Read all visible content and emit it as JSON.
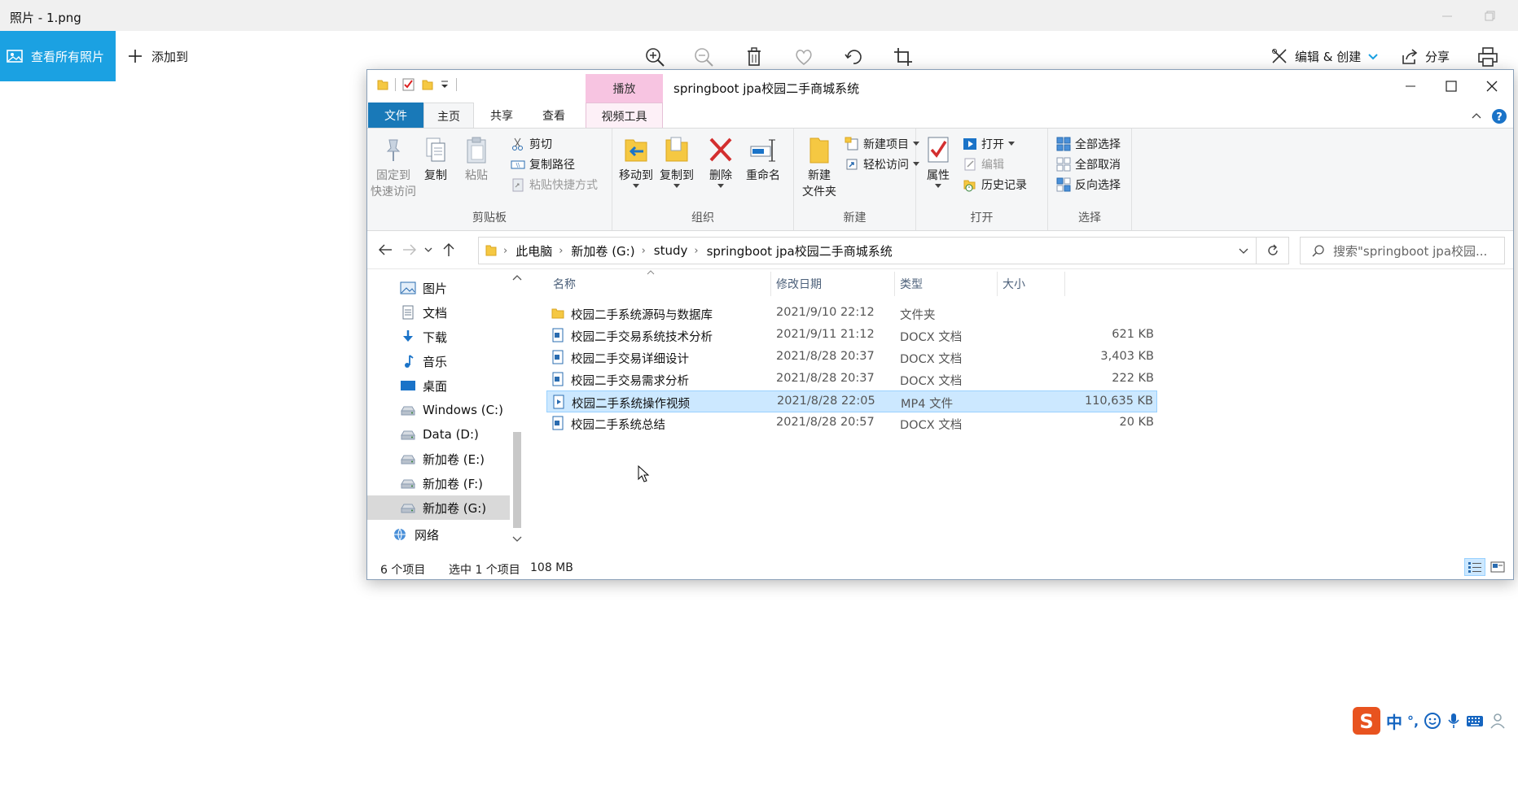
{
  "photos": {
    "title": "照片 - 1.png",
    "view_all": "查看所有照片",
    "add_to": "添加到",
    "edit_create": "编辑 & 创建",
    "share": "分享"
  },
  "explorer": {
    "title": "springboot jpa校园二手商城系统",
    "context_tab": "播放",
    "tabs": {
      "file": "文件",
      "home": "主页",
      "share": "共享",
      "view": "查看",
      "video": "视频工具"
    },
    "ribbon": {
      "clipboard": {
        "label": "剪贴板",
        "pin": "固定到\n快速访问",
        "copy": "复制",
        "paste": "粘贴",
        "cut": "剪切",
        "copy_path": "复制路径",
        "paste_shortcut": "粘贴快捷方式"
      },
      "organize": {
        "label": "组织",
        "move_to": "移动到",
        "copy_to": "复制到",
        "delete": "删除",
        "rename": "重命名"
      },
      "new": {
        "label": "新建",
        "new_folder": "新建\n文件夹",
        "new_item": "新建项目",
        "easy_access": "轻松访问"
      },
      "open": {
        "label": "打开",
        "properties": "属性",
        "open": "打开",
        "edit": "编辑",
        "history": "历史记录"
      },
      "select": {
        "label": "选择",
        "select_all": "全部选择",
        "select_none": "全部取消",
        "invert": "反向选择"
      }
    },
    "breadcrumb": [
      "此电脑",
      "新加卷 (G:)",
      "study",
      "springboot jpa校园二手商城系统"
    ],
    "search_placeholder": "搜索\"springboot jpa校园...",
    "nav_items": [
      {
        "label": "图片",
        "icon": "pictures-icon"
      },
      {
        "label": "文档",
        "icon": "documents-icon"
      },
      {
        "label": "下载",
        "icon": "downloads-icon"
      },
      {
        "label": "音乐",
        "icon": "music-icon"
      },
      {
        "label": "桌面",
        "icon": "desktop-icon"
      },
      {
        "label": "Windows (C:)",
        "icon": "drive-icon"
      },
      {
        "label": "Data (D:)",
        "icon": "drive-icon"
      },
      {
        "label": "新加卷 (E:)",
        "icon": "drive-icon"
      },
      {
        "label": "新加卷 (F:)",
        "icon": "drive-icon"
      },
      {
        "label": "新加卷 (G:)",
        "icon": "drive-icon"
      },
      {
        "label": "网络",
        "icon": "network-icon"
      }
    ],
    "columns": {
      "name": "名称",
      "date": "修改日期",
      "type": "类型",
      "size": "大小"
    },
    "files": [
      {
        "name": "校园二手系统源码与数据库",
        "date": "2021/9/10 22:12",
        "type": "文件夹",
        "size": "",
        "icon": "folder-icon"
      },
      {
        "name": "校园二手交易系统技术分析",
        "date": "2021/9/11 21:12",
        "type": "DOCX 文档",
        "size": "621 KB",
        "icon": "docx-icon"
      },
      {
        "name": "校园二手交易详细设计",
        "date": "2021/8/28 20:37",
        "type": "DOCX 文档",
        "size": "3,403 KB",
        "icon": "docx-icon"
      },
      {
        "name": "校园二手交易需求分析",
        "date": "2021/8/28 20:37",
        "type": "DOCX 文档",
        "size": "222 KB",
        "icon": "docx-icon"
      },
      {
        "name": "校园二手系统操作视频",
        "date": "2021/8/28 22:05",
        "type": "MP4 文件",
        "size": "110,635 KB",
        "icon": "video-icon",
        "selected": true
      },
      {
        "name": "校园二手系统总结",
        "date": "2021/8/28 20:57",
        "type": "DOCX 文档",
        "size": "20 KB",
        "icon": "docx-icon"
      }
    ],
    "status": {
      "count": "6 个项目",
      "selected": "选中 1 个项目",
      "size": "108 MB"
    }
  },
  "ime": {
    "mode": "中",
    "punct": "°,"
  }
}
